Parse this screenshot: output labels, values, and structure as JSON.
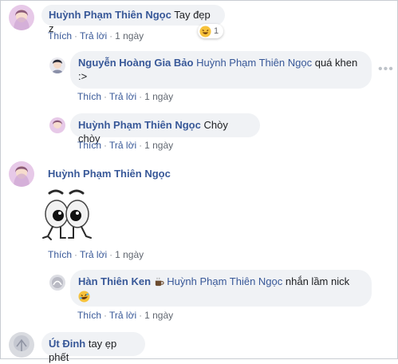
{
  "comments": [
    {
      "author": "Huỳnh Phạm Thiên Ngọc",
      "text": "Tay đẹp z",
      "reaction_icon": "laughing-emoji",
      "reaction_count": "1",
      "like": "Thích",
      "reply": "Trả lời",
      "time": "1 ngày"
    },
    {
      "author": "Nguyễn Hoàng Gia Bảo",
      "tag": "Huỳnh Phạm Thiên Ngọc",
      "text_line1": " quá khen",
      "text_line2": ":>",
      "like": "Thích",
      "reply": "Trả lời",
      "time": "1 ngày"
    },
    {
      "author": "Huỳnh Phạm Thiên Ngọc",
      "text": "Chòy chòy",
      "like": "Thích",
      "reply": "Trả lời",
      "time": "1 ngày"
    },
    {
      "author": "Huỳnh Phạm Thiên Ngọc",
      "sticker": "googly-eyes-sticker",
      "like": "Thích",
      "reply": "Trả lời",
      "time": "1 ngày"
    },
    {
      "author": "Hàn Thiên Ken",
      "author_suffix_icon": "coffee-icon",
      "tag": "Huỳnh Phạm Thiên Ngọc",
      "text": " nhắn lầm nick",
      "emoji": "rofl-emoji",
      "like": "Thích",
      "reply": "Trả lời",
      "time": "1 ngày"
    },
    {
      "author": "Út Đinh",
      "text": "tay ẹp phết"
    }
  ],
  "colors": {
    "link": "#385898",
    "bubble": "#f0f2f5",
    "meta": "#616770"
  }
}
